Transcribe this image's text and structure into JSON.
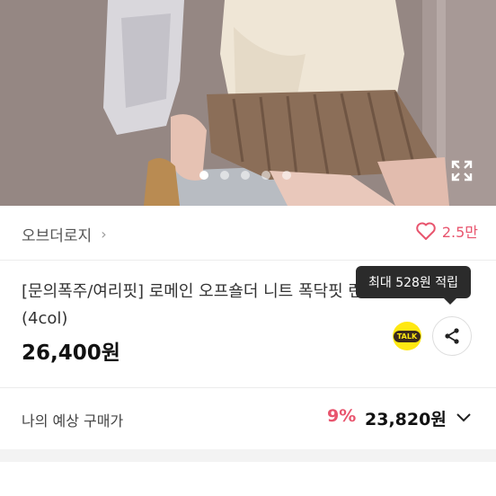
{
  "gallery": {
    "dot_count": 5,
    "active_index": 0
  },
  "brand": {
    "name": "오브더로지",
    "chevron": "›"
  },
  "like": {
    "count": "2.5만",
    "icon": "heart-outline-icon",
    "color": "#e8556e"
  },
  "product": {
    "title": "[문의폭주/여리핏] 로메인 오프숄더 니트 폭닥핏 런칭룩 (4col)",
    "price": "26,400원"
  },
  "tooltip": {
    "text": "최대 528원 적립"
  },
  "share_buttons": {
    "kakao_label": "TALK"
  },
  "expected_price": {
    "label": "나의 예상 구매가",
    "discount": "9%",
    "price": "23,820원"
  }
}
